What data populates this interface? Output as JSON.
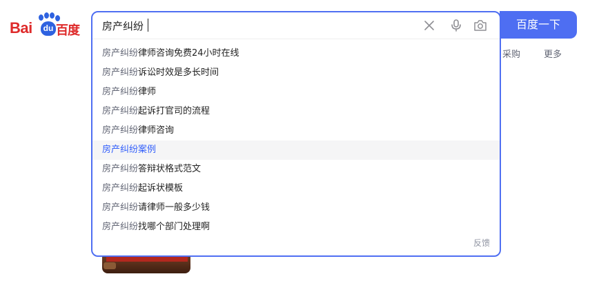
{
  "logo": {
    "bai": "Bai",
    "paw_text": "du",
    "cn": "百度"
  },
  "search": {
    "value": "房产纠纷",
    "button_label": "百度一下"
  },
  "suggestions": [
    {
      "q": "房产纠纷",
      "rest": "律师咨询免费24小时在线"
    },
    {
      "q": "房产纠纷",
      "rest": "诉讼时效是多长时间"
    },
    {
      "q": "房产纠纷",
      "rest": "律师"
    },
    {
      "q": "房产纠纷",
      "rest": "起诉打官司的流程"
    },
    {
      "q": "房产纠纷",
      "rest": "律师咨询"
    },
    {
      "q": "房产纠纷",
      "rest": "案例"
    },
    {
      "q": "房产纠纷",
      "rest": "答辩状格式范文"
    },
    {
      "q": "房产纠纷",
      "rest": "起诉状模板"
    },
    {
      "q": "房产纠纷",
      "rest": "请律师一般多少钱"
    },
    {
      "q": "房产纠纷",
      "rest": "找哪个部门处理啊"
    }
  ],
  "active_suggestion_index": 5,
  "feedback_label": "反馈",
  "tabs": {
    "purchase": "采购",
    "more": "更多"
  },
  "icons": [
    "clear-icon",
    "microphone-icon",
    "camera-icon",
    "paw-icon"
  ],
  "colors": {
    "brand_blue": "#4e6ef2",
    "brand_red": "#de2a2a",
    "highlight": "#315efb"
  }
}
